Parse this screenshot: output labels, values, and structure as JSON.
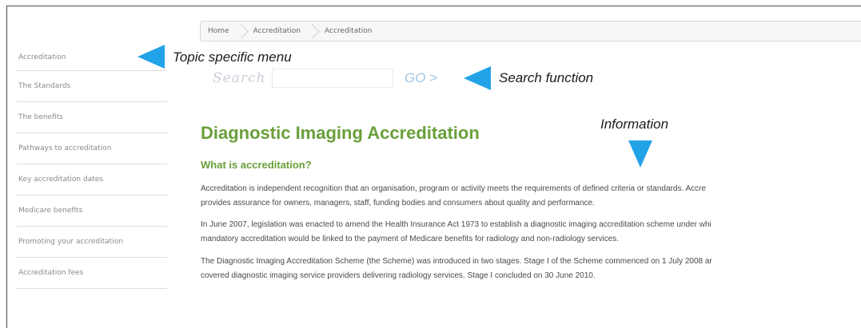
{
  "breadcrumb": [
    "Home",
    "Accreditation",
    "Accreditation"
  ],
  "sidebar": {
    "items": [
      {
        "label": "Accreditation"
      },
      {
        "label": "The Standards"
      },
      {
        "label": "The benefits"
      },
      {
        "label": "Pathways to accreditation"
      },
      {
        "label": "Key accreditation dates"
      },
      {
        "label": "Medicare benefits"
      },
      {
        "label": "Promoting your accreditation"
      },
      {
        "label": "Accreditation fees"
      }
    ]
  },
  "search": {
    "label": "Search",
    "value": "",
    "placeholder": "",
    "go_label": "GO >"
  },
  "annotations": {
    "menu": "Topic specific menu",
    "search": "Search function",
    "info": "Information",
    "arrow_color": "#22a3e8"
  },
  "content": {
    "title": "Diagnostic Imaging Accreditation",
    "subheading": "What is accreditation?",
    "paragraphs": [
      {
        "line1": "Accreditation is independent recognition that an organisation, program or activity meets the requirements of defined criteria or standards. Accre",
        "line2": "provides assurance for owners, managers, staff, funding bodies and consumers about quality and performance."
      },
      {
        "line1": "In June 2007, legislation was enacted to amend the Health Insurance Act 1973 to establish a diagnostic imaging accreditation scheme under whi",
        "line2": "mandatory accreditation would be linked to the payment of Medicare benefits for radiology and non-radiology services."
      },
      {
        "line1": "The Diagnostic Imaging Accreditation Scheme (the Scheme) was introduced in two stages. Stage I of the Scheme commenced on 1 July 2008 ar",
        "line2": "covered diagnostic imaging service providers delivering radiology services. Stage I concluded on 30 June 2010."
      }
    ]
  },
  "colors": {
    "title_green": "#6a9f3a",
    "go_blue": "#9ec6e6",
    "sidebar_text": "#8a8a8a"
  }
}
